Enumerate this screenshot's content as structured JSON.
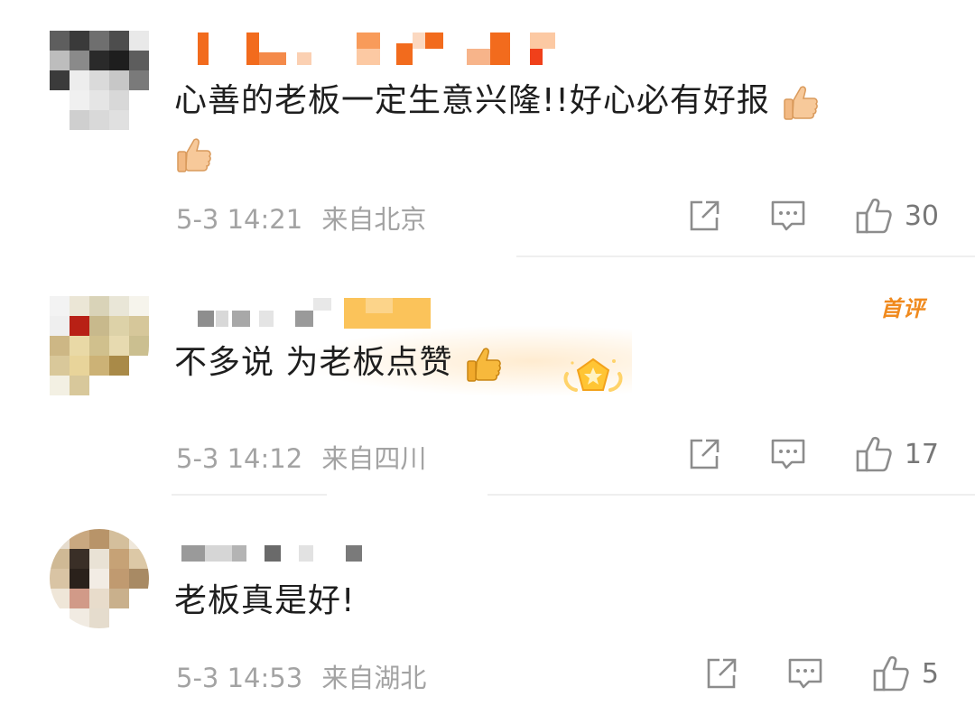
{
  "comments": [
    {
      "text": "心善的老板一定生意兴隆!!好心必有好报",
      "time": "5-3 14:21",
      "location": "来自北京",
      "likes": "30",
      "name_colors": [
        "#f26b1d",
        "#f89b5a",
        "#fcc9a3"
      ]
    },
    {
      "text": "不多说 为老板点赞",
      "time": "5-3 14:12",
      "location": "来自四川",
      "likes": "17",
      "badge": "首评"
    },
    {
      "text": "老板真是好!",
      "time": "5-3 14:53",
      "location": "来自湖北",
      "likes": "5"
    }
  ],
  "icons": {
    "share": "share-icon",
    "comment": "comment-icon",
    "like": "thumbs-up-icon",
    "emoji": "thumbs-up-emoji-icon",
    "medal": "medal-badge-icon"
  },
  "colors": {
    "accent": "#f08a1e",
    "meta": "#a3a3a3",
    "icon": "#8c8c8c"
  }
}
